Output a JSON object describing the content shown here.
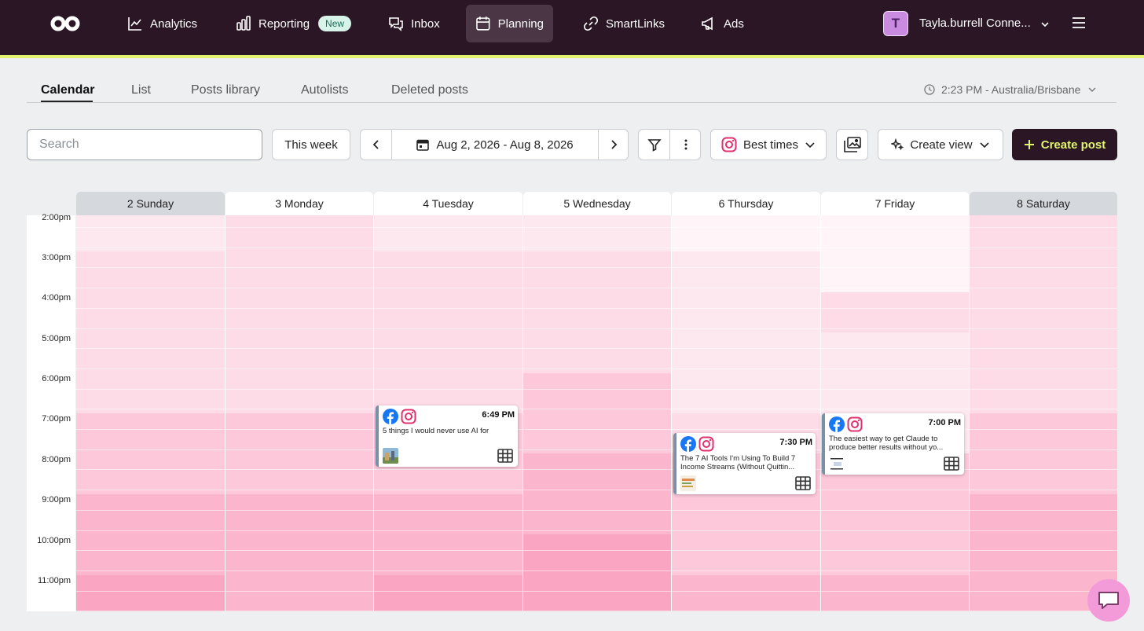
{
  "nav": {
    "items": [
      {
        "label": "Analytics",
        "icon": "chart-line-icon"
      },
      {
        "label": "Reporting",
        "icon": "bar-chart-icon",
        "badge": "New"
      },
      {
        "label": "Inbox",
        "icon": "chat-bubbles-icon"
      },
      {
        "label": "Planning",
        "icon": "calendar-icon",
        "active": true
      },
      {
        "label": "SmartLinks",
        "icon": "link-icon"
      },
      {
        "label": "Ads",
        "icon": "megaphone-icon"
      }
    ],
    "account": {
      "initial": "T",
      "name": "Tayla.burrell Conne..."
    }
  },
  "subtabs": {
    "items": [
      "Calendar",
      "List",
      "Posts library",
      "Autolists",
      "Deleted posts"
    ],
    "active": "Calendar",
    "timezone": "2:23 PM - Australia/Brisbane"
  },
  "toolbar": {
    "search_placeholder": "Search",
    "this_week": "This week",
    "date_range": "Aug 2, 2026 - Aug 8, 2026",
    "best_times": "Best times",
    "create_view": "Create view",
    "create_post": "Create post"
  },
  "calendar": {
    "days": [
      {
        "label": "2 Sunday",
        "weekend": true
      },
      {
        "label": "3 Monday",
        "weekend": false
      },
      {
        "label": "4 Tuesday",
        "weekend": false
      },
      {
        "label": "5 Wednesday",
        "weekend": false
      },
      {
        "label": "6 Thursday",
        "weekend": false
      },
      {
        "label": "7 Friday",
        "weekend": false
      },
      {
        "label": "8 Saturday",
        "weekend": true
      }
    ],
    "hours": [
      "2:00pm",
      "3:00pm",
      "4:00pm",
      "5:00pm",
      "6:00pm",
      "7:00pm",
      "8:00pm",
      "9:00pm",
      "10:00pm",
      "11:00pm"
    ],
    "posts": [
      {
        "day": 2,
        "time": "6:49 PM",
        "text": "5 things I would never use AI for"
      },
      {
        "day": 4,
        "time": "7:30 PM",
        "text": "The 7 AI Tools I'm Using To Build 7 Income Streams (Without Quittin..."
      },
      {
        "day": 5,
        "time": "7:00 PM",
        "text": "The easiest way to get Claude to produce better results without yo..."
      }
    ]
  },
  "colors": {
    "nav_bg": "#2b1625",
    "accent": "#e3f56f",
    "facebook": "#1877f2",
    "instagram": "#e1306c"
  }
}
